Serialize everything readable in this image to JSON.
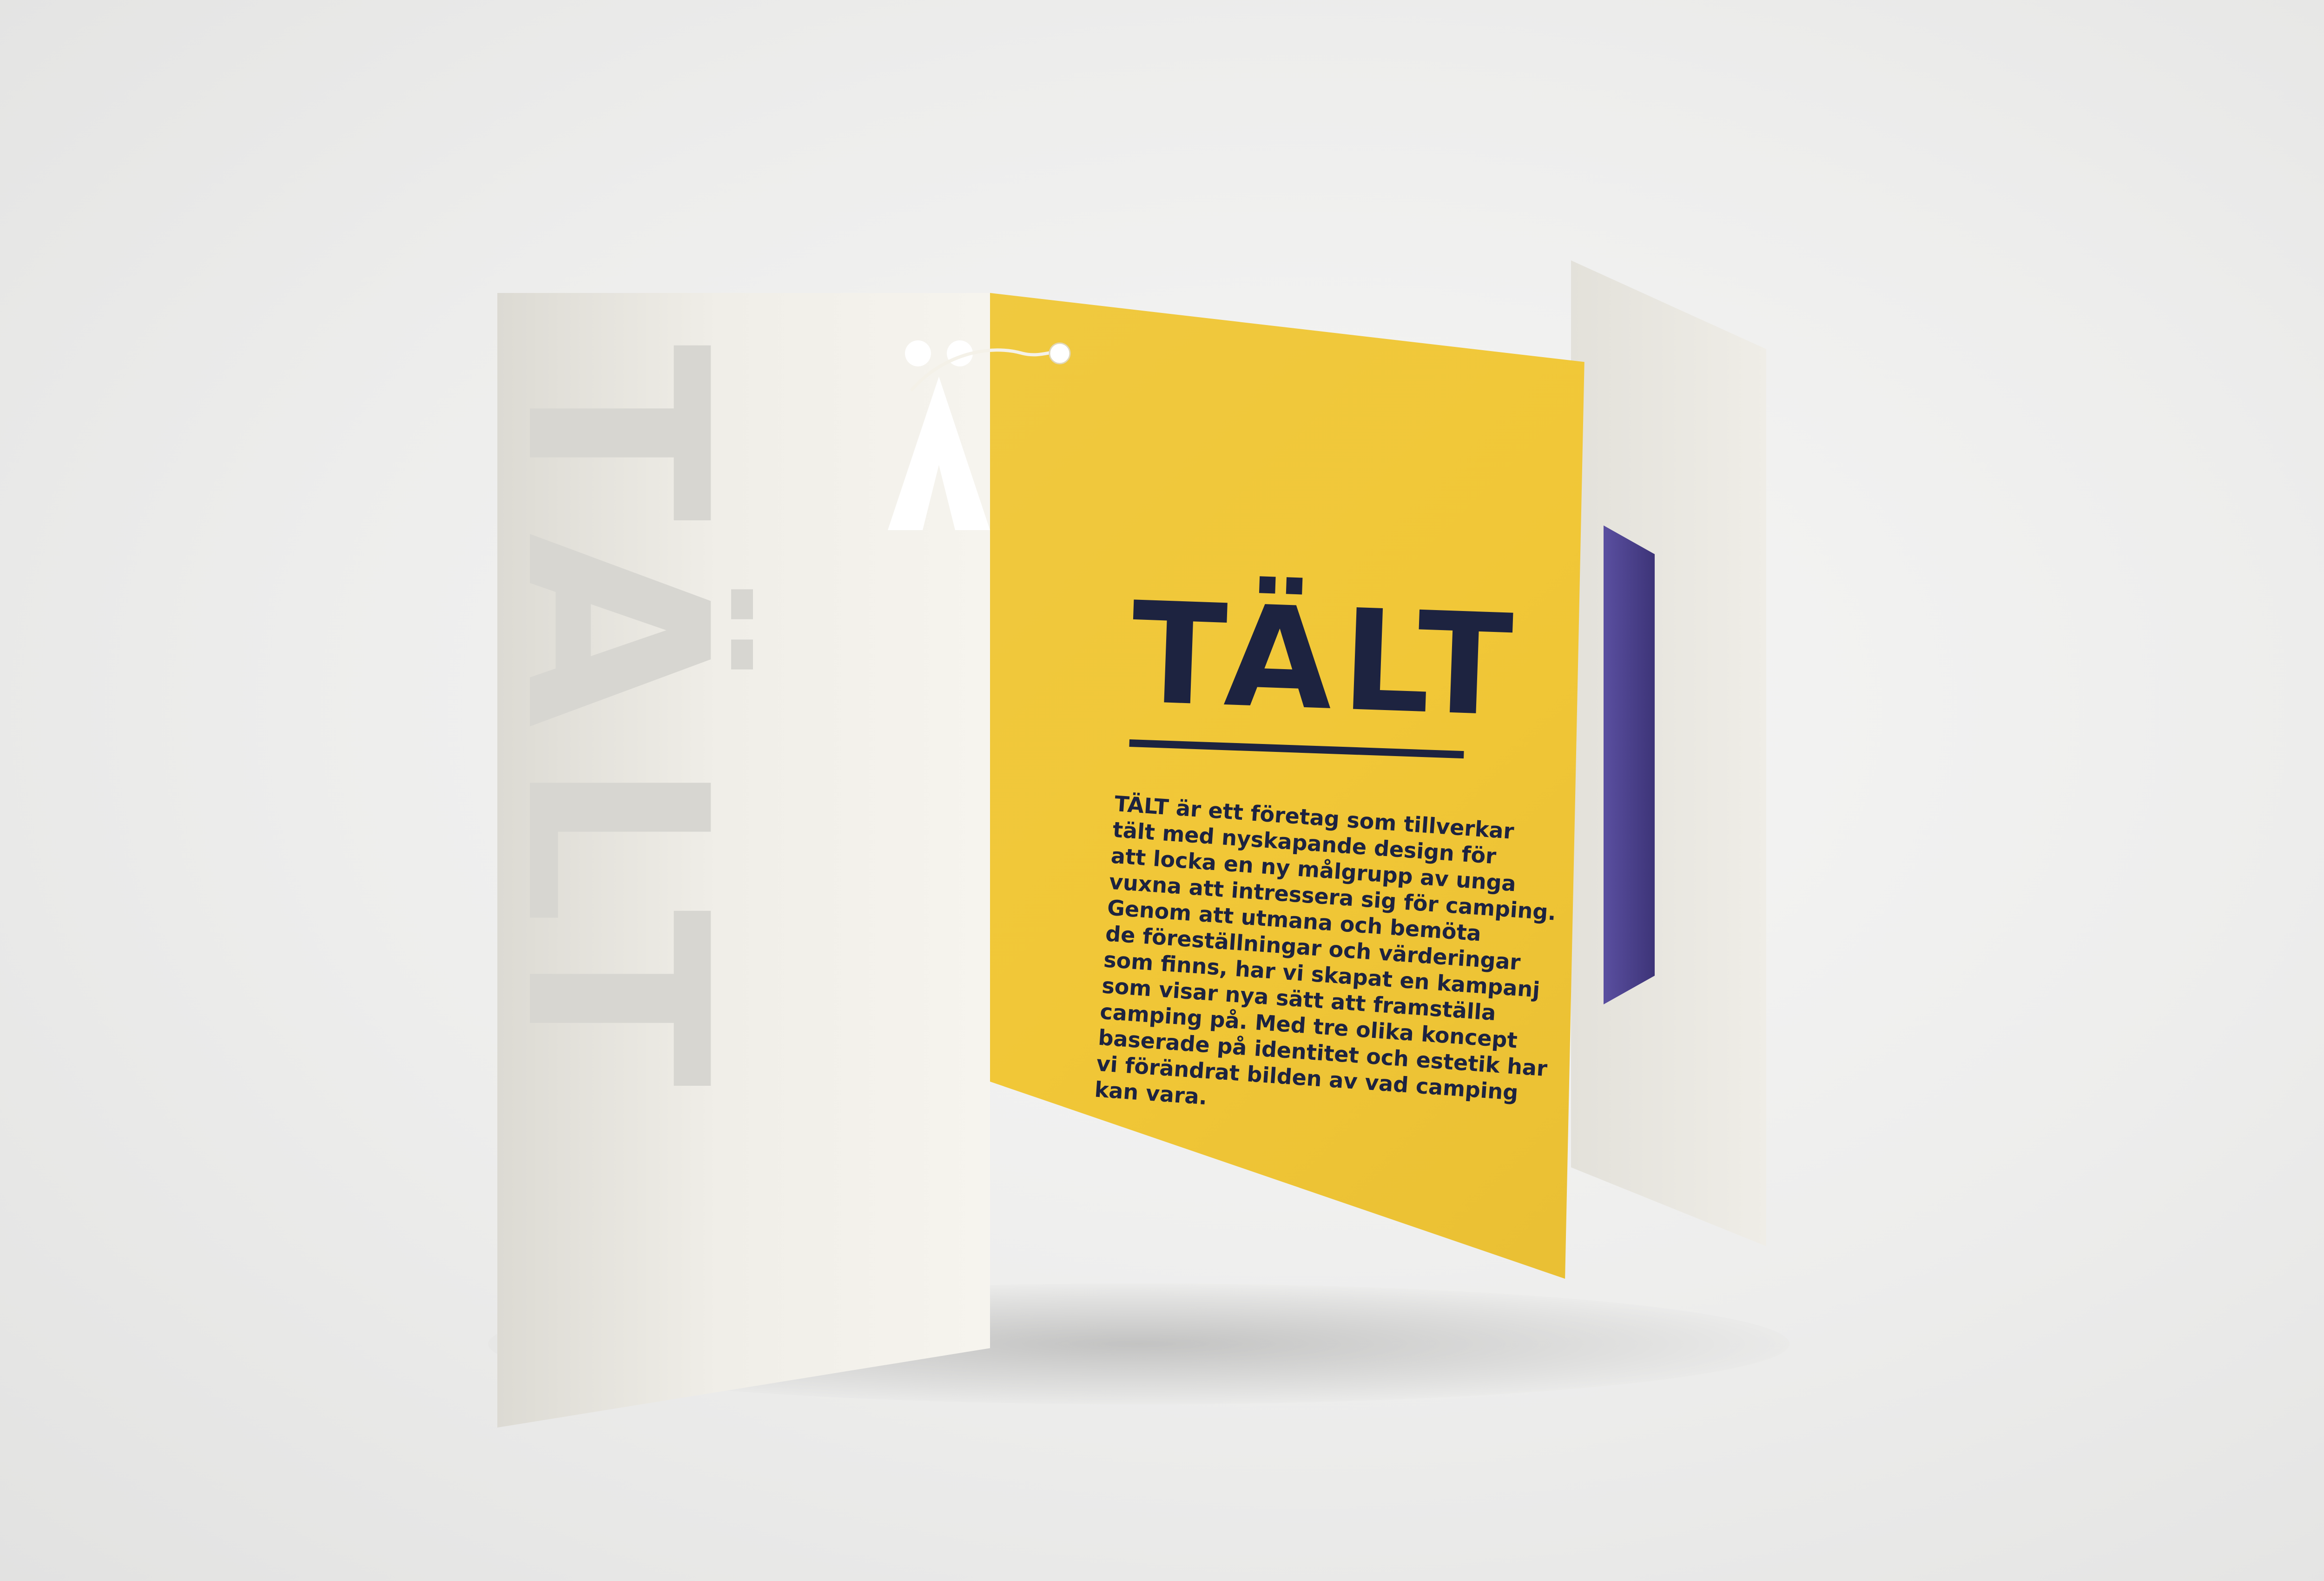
{
  "brand": {
    "title": "TÄLT",
    "watermark": "TÄLT",
    "logo_mark": "Ä"
  },
  "body_lines": [
    "TÄLT är ett företag som tillverkar",
    "tält med nyskapande design för",
    "att locka en ny målgrupp av unga",
    "vuxna att intressera sig för camping.",
    "Genom att utmana och bemöta",
    "de föreställningar och värderingar",
    "som finns, har vi skapat en kampanj",
    "som visar nya sätt att framställa",
    "camping på. Med tre olika koncept",
    "baserade på identitet och estetik har",
    "vi förändrat bilden av vad camping",
    "kan vara."
  ],
  "colors": {
    "card_yellow": "#f1c737",
    "ink_navy": "#1d2340",
    "paper": "#f3f1ea",
    "background": "#ededec"
  }
}
